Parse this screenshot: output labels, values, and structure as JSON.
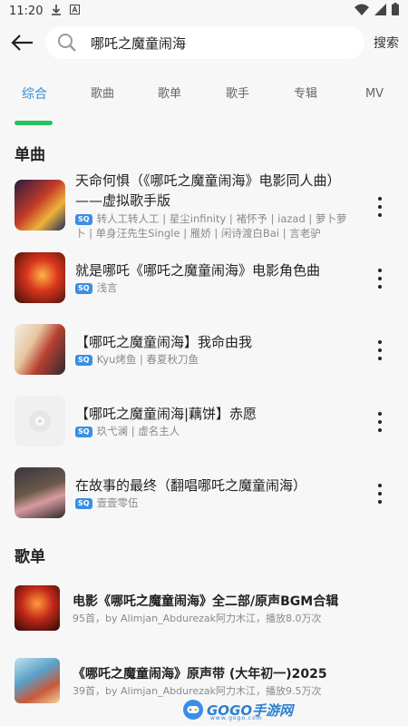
{
  "status_bar": {
    "time": "11:20"
  },
  "header": {
    "query": "哪吒之魔童闹海",
    "search_label": "搜索"
  },
  "tabs": [
    {
      "label": "综合",
      "active": true
    },
    {
      "label": "歌曲"
    },
    {
      "label": "歌单"
    },
    {
      "label": "歌手"
    },
    {
      "label": "专辑"
    },
    {
      "label": "MV"
    }
  ],
  "colors": {
    "accent": "#2f8fd6",
    "indicator": "#22c45e",
    "badge": "#3a8ee6"
  },
  "songs_section": {
    "title": "单曲",
    "badge": "SQ",
    "items": [
      {
        "title": "天命何惧（《哪吒之魔童闹海》电影同人曲）——虚拟歌手版",
        "meta": "转人工转人工 | 星尘infinity | 褚怀予 | iazad | 萝卜萝卜 | 单身汪先生Single | 雁娇 | 闲诗渡白Bai | 言老驴"
      },
      {
        "title": "就是哪吒《哪吒之魔童闹海》电影角色曲",
        "meta": "浅言"
      },
      {
        "title": "【哪吒之魔童闹海】我命由我",
        "meta": "Kyu烤鱼 | 春夏秋刀鱼"
      },
      {
        "title": "【哪吒之魔童闹海|藕饼】赤愿",
        "meta": "玖弋澜 | 虚名主人"
      },
      {
        "title": "在故事的最终（翻唱哪吒之魔童闹海）",
        "meta": "壹壹零伍"
      }
    ]
  },
  "playlists_section": {
    "title": "歌单",
    "items": [
      {
        "title": "电影《哪吒之魔童闹海》全二部/原声BGM合辑",
        "meta": "95首，by Alimjan_Abdurezak阿力木江，播放8.0万次"
      },
      {
        "title": "《哪吒之魔童闹海》原声带 (大年初一)2025",
        "meta": "39首，by Alimjan_Abdurezak阿力木江，播放9.5万次"
      }
    ]
  },
  "watermark": {
    "brand": "GOGO手游网",
    "url": "www.gogo.com"
  }
}
